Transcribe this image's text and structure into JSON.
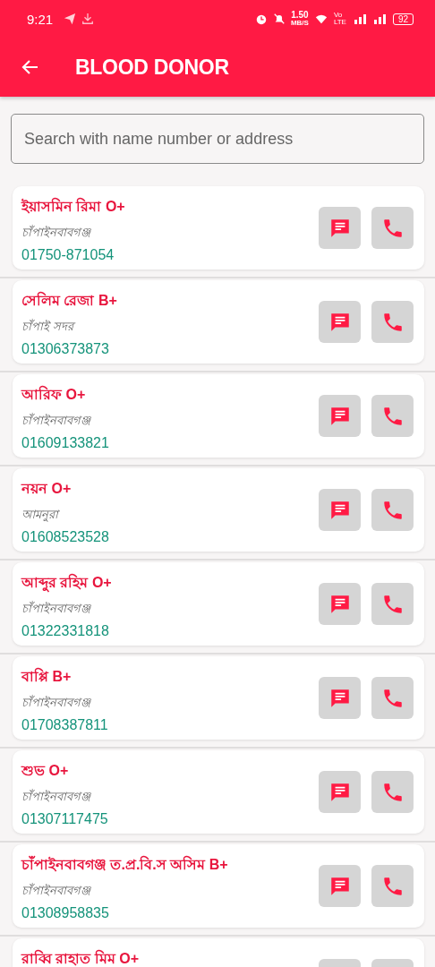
{
  "status_bar": {
    "time": "9:21",
    "speed_value": "1.50",
    "speed_unit": "MB/S",
    "network": "Vo LTE",
    "battery": "92"
  },
  "app_bar": {
    "title": "BLOOD DONOR"
  },
  "search": {
    "placeholder": "Search with name number or address"
  },
  "donors": [
    {
      "name": "ইয়াসমিন রিমা O+",
      "address": "চাঁপাইনবাবগঞ্জ",
      "phone": "01750-871054"
    },
    {
      "name": "সেলিম রেজা B+",
      "address": "চাঁপাই সদর",
      "phone": "01306373873"
    },
    {
      "name": "আরিফ O+",
      "address": "চাঁপাইনবাবগঞ্জ",
      "phone": "01609133821"
    },
    {
      "name": "নয়ন  O+",
      "address": "আমনুরা",
      "phone": "01608523528"
    },
    {
      "name": "আব্দুর রহিম  O+",
      "address": "চাঁপাইনবাবগঞ্জ",
      "phone": "01322331818"
    },
    {
      "name": "বাপ্পি B+",
      "address": "চাঁপাইনবাবগঞ্জ",
      "phone": "01708387811"
    },
    {
      "name": "শুভ O+",
      "address": "চাঁপাইনবাবগঞ্জ",
      "phone": "01307117475"
    },
    {
      "name": "চাঁপাইনবাবগঞ্জ  ত.প্র.বি.স অসিম B+",
      "address": "চাঁপাইনবাবগঞ্জ",
      "phone": "01308958835"
    },
    {
      "name": "রাব্বি রাহাত মিম O+"
    }
  ]
}
